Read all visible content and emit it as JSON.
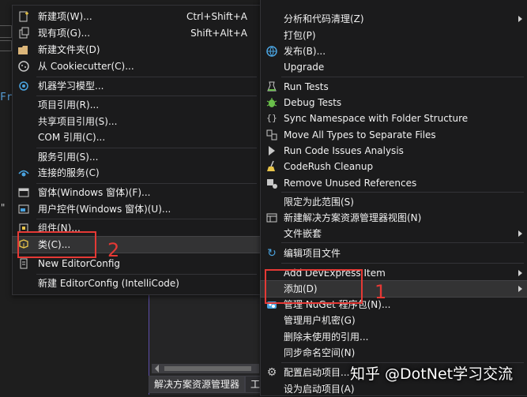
{
  "background": {
    "code_fragment": "Fr",
    "code_fragment2": "\""
  },
  "solution_explorer": {
    "tabs": [
      "解决方案资源管理器",
      "工具"
    ]
  },
  "left_menu": {
    "items": [
      {
        "label": "新建项(W)...",
        "shortcut": "Ctrl+Shift+A",
        "icon": "new-item-icon"
      },
      {
        "label": "现有项(G)...",
        "shortcut": "Shift+Alt+A",
        "icon": "existing-item-icon"
      },
      {
        "label": "新建文件夹(D)",
        "shortcut": "",
        "icon": "new-folder-icon"
      },
      {
        "label": "从 Cookiecutter(C)...",
        "shortcut": "",
        "icon": "cookiecutter-icon"
      },
      {
        "label": "机器学习模型...",
        "shortcut": "",
        "icon": "ml-model-icon"
      },
      {
        "label": "项目引用(R)...",
        "shortcut": "",
        "icon": ""
      },
      {
        "label": "共享项目引用(S)...",
        "shortcut": "",
        "icon": ""
      },
      {
        "label": "COM 引用(C)...",
        "shortcut": "",
        "icon": ""
      },
      {
        "label": "服务引用(S)...",
        "shortcut": "",
        "icon": ""
      },
      {
        "label": "连接的服务(C)",
        "shortcut": "",
        "icon": "connected-service-icon"
      },
      {
        "label": "窗体(Windows 窗体)(F)...",
        "shortcut": "",
        "icon": "form-icon"
      },
      {
        "label": "用户控件(Windows 窗体)(U)...",
        "shortcut": "",
        "icon": "user-control-icon"
      },
      {
        "label": "组件(N)...",
        "shortcut": "",
        "icon": "component-icon"
      },
      {
        "label": "类(C)...",
        "shortcut": "",
        "icon": "class-icon"
      },
      {
        "label": "New EditorConfig",
        "shortcut": "",
        "icon": "editorconfig-icon"
      },
      {
        "label": "新建 EditorConfig (IntelliCode)",
        "shortcut": "",
        "icon": ""
      }
    ]
  },
  "right_menu": {
    "items": [
      {
        "label": "分析和代码清理(Z)",
        "icon": "",
        "submenu": true
      },
      {
        "label": "打包(P)",
        "icon": "",
        "submenu": false
      },
      {
        "label": "发布(B)...",
        "icon": "publish-icon",
        "submenu": false
      },
      {
        "label": "Upgrade",
        "icon": "",
        "submenu": false
      },
      {
        "label": "Run Tests",
        "icon": "run-tests-icon",
        "submenu": false
      },
      {
        "label": "Debug Tests",
        "icon": "debug-tests-icon",
        "submenu": false
      },
      {
        "label": "Sync Namespace with Folder Structure",
        "icon": "sync-namespace-icon",
        "submenu": false
      },
      {
        "label": "Move All Types to Separate Files",
        "icon": "move-types-icon",
        "submenu": false
      },
      {
        "label": "Run Code Issues Analysis",
        "icon": "code-issues-icon",
        "submenu": false
      },
      {
        "label": "CodeRush Cleanup",
        "icon": "cleanup-icon",
        "submenu": false
      },
      {
        "label": "Remove Unused References",
        "icon": "remove-references-icon",
        "submenu": false
      },
      {
        "label": "限定为此范围(S)",
        "icon": "",
        "submenu": false
      },
      {
        "label": "新建解决方案资源管理器视图(N)",
        "icon": "new-view-icon",
        "submenu": false
      },
      {
        "label": "文件嵌套",
        "icon": "",
        "submenu": true
      },
      {
        "label": "编辑项目文件",
        "icon": "edit-project-icon",
        "submenu": false
      },
      {
        "label": "Add DevExpress Item",
        "icon": "",
        "submenu": true
      },
      {
        "label": "添加(D)",
        "icon": "",
        "submenu": true
      },
      {
        "label": "管理 NuGet 程序包(N)...",
        "icon": "nuget-icon",
        "submenu": false
      },
      {
        "label": "管理用户机密(G)",
        "icon": "",
        "submenu": false
      },
      {
        "label": "删除未使用的引用...",
        "icon": "",
        "submenu": false
      },
      {
        "label": "同步命名空间(N)",
        "icon": "",
        "submenu": false
      },
      {
        "label": "配置启动项目...",
        "icon": "gear-icon",
        "submenu": false
      },
      {
        "label": "设为启动项目(A)",
        "icon": "",
        "submenu": false
      }
    ]
  },
  "annotations": {
    "step1": "1",
    "step2": "2"
  },
  "watermark": "知乎 @DotNet学习交流",
  "colors": {
    "menu_bg": "#1b1b1c",
    "highlight": "#333334",
    "annotation_red": "#e53935",
    "accent_purple": "#5b4da8"
  }
}
